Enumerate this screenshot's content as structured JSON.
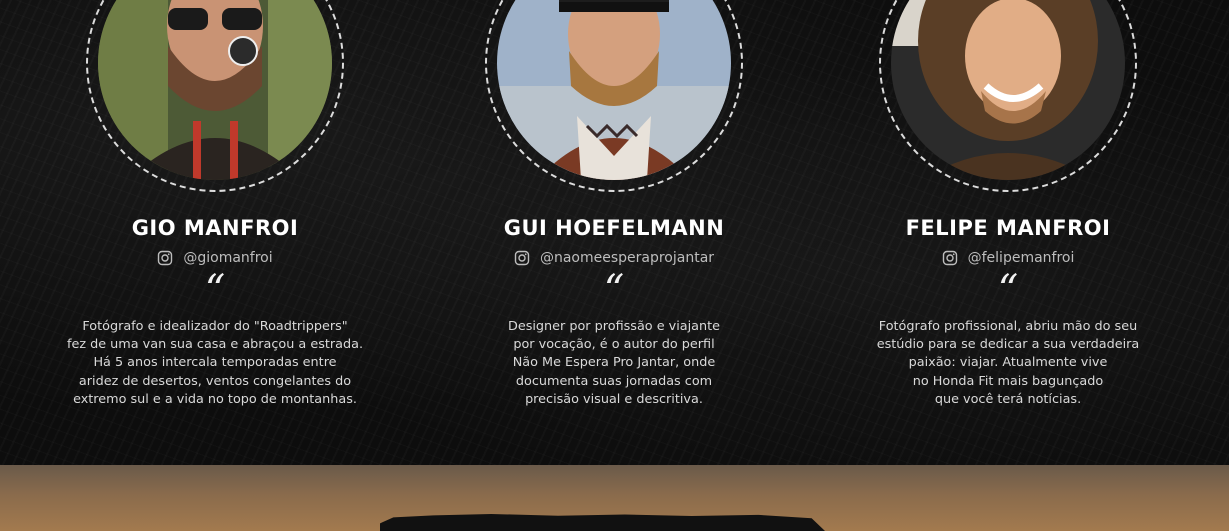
{
  "profiles": [
    {
      "name": "GIO MANFROI",
      "handle": "@giomanfroi",
      "quote_mark": "“",
      "bio": [
        "Fotógrafo e idealizador do \"Roadtrippers\"",
        "fez de uma van sua casa e abraçou a estrada.",
        "Há 5 anos intercala temporadas entre",
        "aridez de desertos, ventos congelantes do",
        "extremo sul e a vida no topo de montanhas."
      ]
    },
    {
      "name": "GUI HOEFELMANN",
      "handle": "@naomeesperaprojantar",
      "quote_mark": "“",
      "bio": [
        "Designer por profissão e viajante",
        "por vocação, é o autor do perfil",
        "Não Me Espera Pro Jantar, onde",
        "documenta suas jornadas com",
        "precisão visual e descritiva."
      ]
    },
    {
      "name": "FELIPE MANFROI",
      "handle": "@felipemanfroi",
      "quote_mark": "“",
      "bio": [
        "Fotógrafo profissional, abriu mão do seu",
        "estúdio para se dedicar a sua verdadeira",
        "paixão: viajar. Atualmente vive",
        "no Honda Fit mais bagunçado",
        "que você terá notícias."
      ]
    }
  ],
  "icons": {
    "social": "instagram-icon"
  },
  "colors": {
    "background": "#0d0d0d",
    "text": "#ffffff",
    "muted": "#bdbdbd",
    "banner": "#a37a4e"
  }
}
